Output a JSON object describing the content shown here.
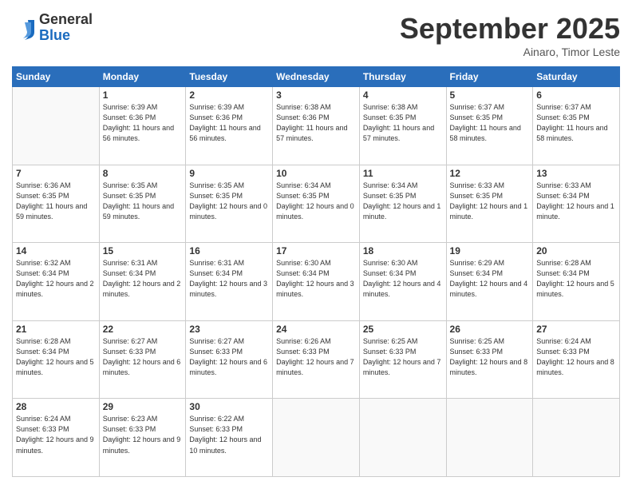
{
  "logo": {
    "general": "General",
    "blue": "Blue"
  },
  "header": {
    "month_year": "September 2025",
    "location": "Ainaro, Timor Leste"
  },
  "days_of_week": [
    "Sunday",
    "Monday",
    "Tuesday",
    "Wednesday",
    "Thursday",
    "Friday",
    "Saturday"
  ],
  "weeks": [
    [
      {
        "day": "",
        "info": ""
      },
      {
        "day": "1",
        "info": "Sunrise: 6:39 AM\nSunset: 6:36 PM\nDaylight: 11 hours\nand 56 minutes."
      },
      {
        "day": "2",
        "info": "Sunrise: 6:39 AM\nSunset: 6:36 PM\nDaylight: 11 hours\nand 56 minutes."
      },
      {
        "day": "3",
        "info": "Sunrise: 6:38 AM\nSunset: 6:36 PM\nDaylight: 11 hours\nand 57 minutes."
      },
      {
        "day": "4",
        "info": "Sunrise: 6:38 AM\nSunset: 6:35 PM\nDaylight: 11 hours\nand 57 minutes."
      },
      {
        "day": "5",
        "info": "Sunrise: 6:37 AM\nSunset: 6:35 PM\nDaylight: 11 hours\nand 58 minutes."
      },
      {
        "day": "6",
        "info": "Sunrise: 6:37 AM\nSunset: 6:35 PM\nDaylight: 11 hours\nand 58 minutes."
      }
    ],
    [
      {
        "day": "7",
        "info": "Sunrise: 6:36 AM\nSunset: 6:35 PM\nDaylight: 11 hours\nand 59 minutes."
      },
      {
        "day": "8",
        "info": "Sunrise: 6:35 AM\nSunset: 6:35 PM\nDaylight: 11 hours\nand 59 minutes."
      },
      {
        "day": "9",
        "info": "Sunrise: 6:35 AM\nSunset: 6:35 PM\nDaylight: 12 hours\nand 0 minutes."
      },
      {
        "day": "10",
        "info": "Sunrise: 6:34 AM\nSunset: 6:35 PM\nDaylight: 12 hours\nand 0 minutes."
      },
      {
        "day": "11",
        "info": "Sunrise: 6:34 AM\nSunset: 6:35 PM\nDaylight: 12 hours\nand 1 minute."
      },
      {
        "day": "12",
        "info": "Sunrise: 6:33 AM\nSunset: 6:35 PM\nDaylight: 12 hours\nand 1 minute."
      },
      {
        "day": "13",
        "info": "Sunrise: 6:33 AM\nSunset: 6:34 PM\nDaylight: 12 hours\nand 1 minute."
      }
    ],
    [
      {
        "day": "14",
        "info": "Sunrise: 6:32 AM\nSunset: 6:34 PM\nDaylight: 12 hours\nand 2 minutes."
      },
      {
        "day": "15",
        "info": "Sunrise: 6:31 AM\nSunset: 6:34 PM\nDaylight: 12 hours\nand 2 minutes."
      },
      {
        "day": "16",
        "info": "Sunrise: 6:31 AM\nSunset: 6:34 PM\nDaylight: 12 hours\nand 3 minutes."
      },
      {
        "day": "17",
        "info": "Sunrise: 6:30 AM\nSunset: 6:34 PM\nDaylight: 12 hours\nand 3 minutes."
      },
      {
        "day": "18",
        "info": "Sunrise: 6:30 AM\nSunset: 6:34 PM\nDaylight: 12 hours\nand 4 minutes."
      },
      {
        "day": "19",
        "info": "Sunrise: 6:29 AM\nSunset: 6:34 PM\nDaylight: 12 hours\nand 4 minutes."
      },
      {
        "day": "20",
        "info": "Sunrise: 6:28 AM\nSunset: 6:34 PM\nDaylight: 12 hours\nand 5 minutes."
      }
    ],
    [
      {
        "day": "21",
        "info": "Sunrise: 6:28 AM\nSunset: 6:34 PM\nDaylight: 12 hours\nand 5 minutes."
      },
      {
        "day": "22",
        "info": "Sunrise: 6:27 AM\nSunset: 6:33 PM\nDaylight: 12 hours\nand 6 minutes."
      },
      {
        "day": "23",
        "info": "Sunrise: 6:27 AM\nSunset: 6:33 PM\nDaylight: 12 hours\nand 6 minutes."
      },
      {
        "day": "24",
        "info": "Sunrise: 6:26 AM\nSunset: 6:33 PM\nDaylight: 12 hours\nand 7 minutes."
      },
      {
        "day": "25",
        "info": "Sunrise: 6:25 AM\nSunset: 6:33 PM\nDaylight: 12 hours\nand 7 minutes."
      },
      {
        "day": "26",
        "info": "Sunrise: 6:25 AM\nSunset: 6:33 PM\nDaylight: 12 hours\nand 8 minutes."
      },
      {
        "day": "27",
        "info": "Sunrise: 6:24 AM\nSunset: 6:33 PM\nDaylight: 12 hours\nand 8 minutes."
      }
    ],
    [
      {
        "day": "28",
        "info": "Sunrise: 6:24 AM\nSunset: 6:33 PM\nDaylight: 12 hours\nand 9 minutes."
      },
      {
        "day": "29",
        "info": "Sunrise: 6:23 AM\nSunset: 6:33 PM\nDaylight: 12 hours\nand 9 minutes."
      },
      {
        "day": "30",
        "info": "Sunrise: 6:22 AM\nSunset: 6:33 PM\nDaylight: 12 hours\nand 10 minutes."
      },
      {
        "day": "",
        "info": ""
      },
      {
        "day": "",
        "info": ""
      },
      {
        "day": "",
        "info": ""
      },
      {
        "day": "",
        "info": ""
      }
    ]
  ]
}
